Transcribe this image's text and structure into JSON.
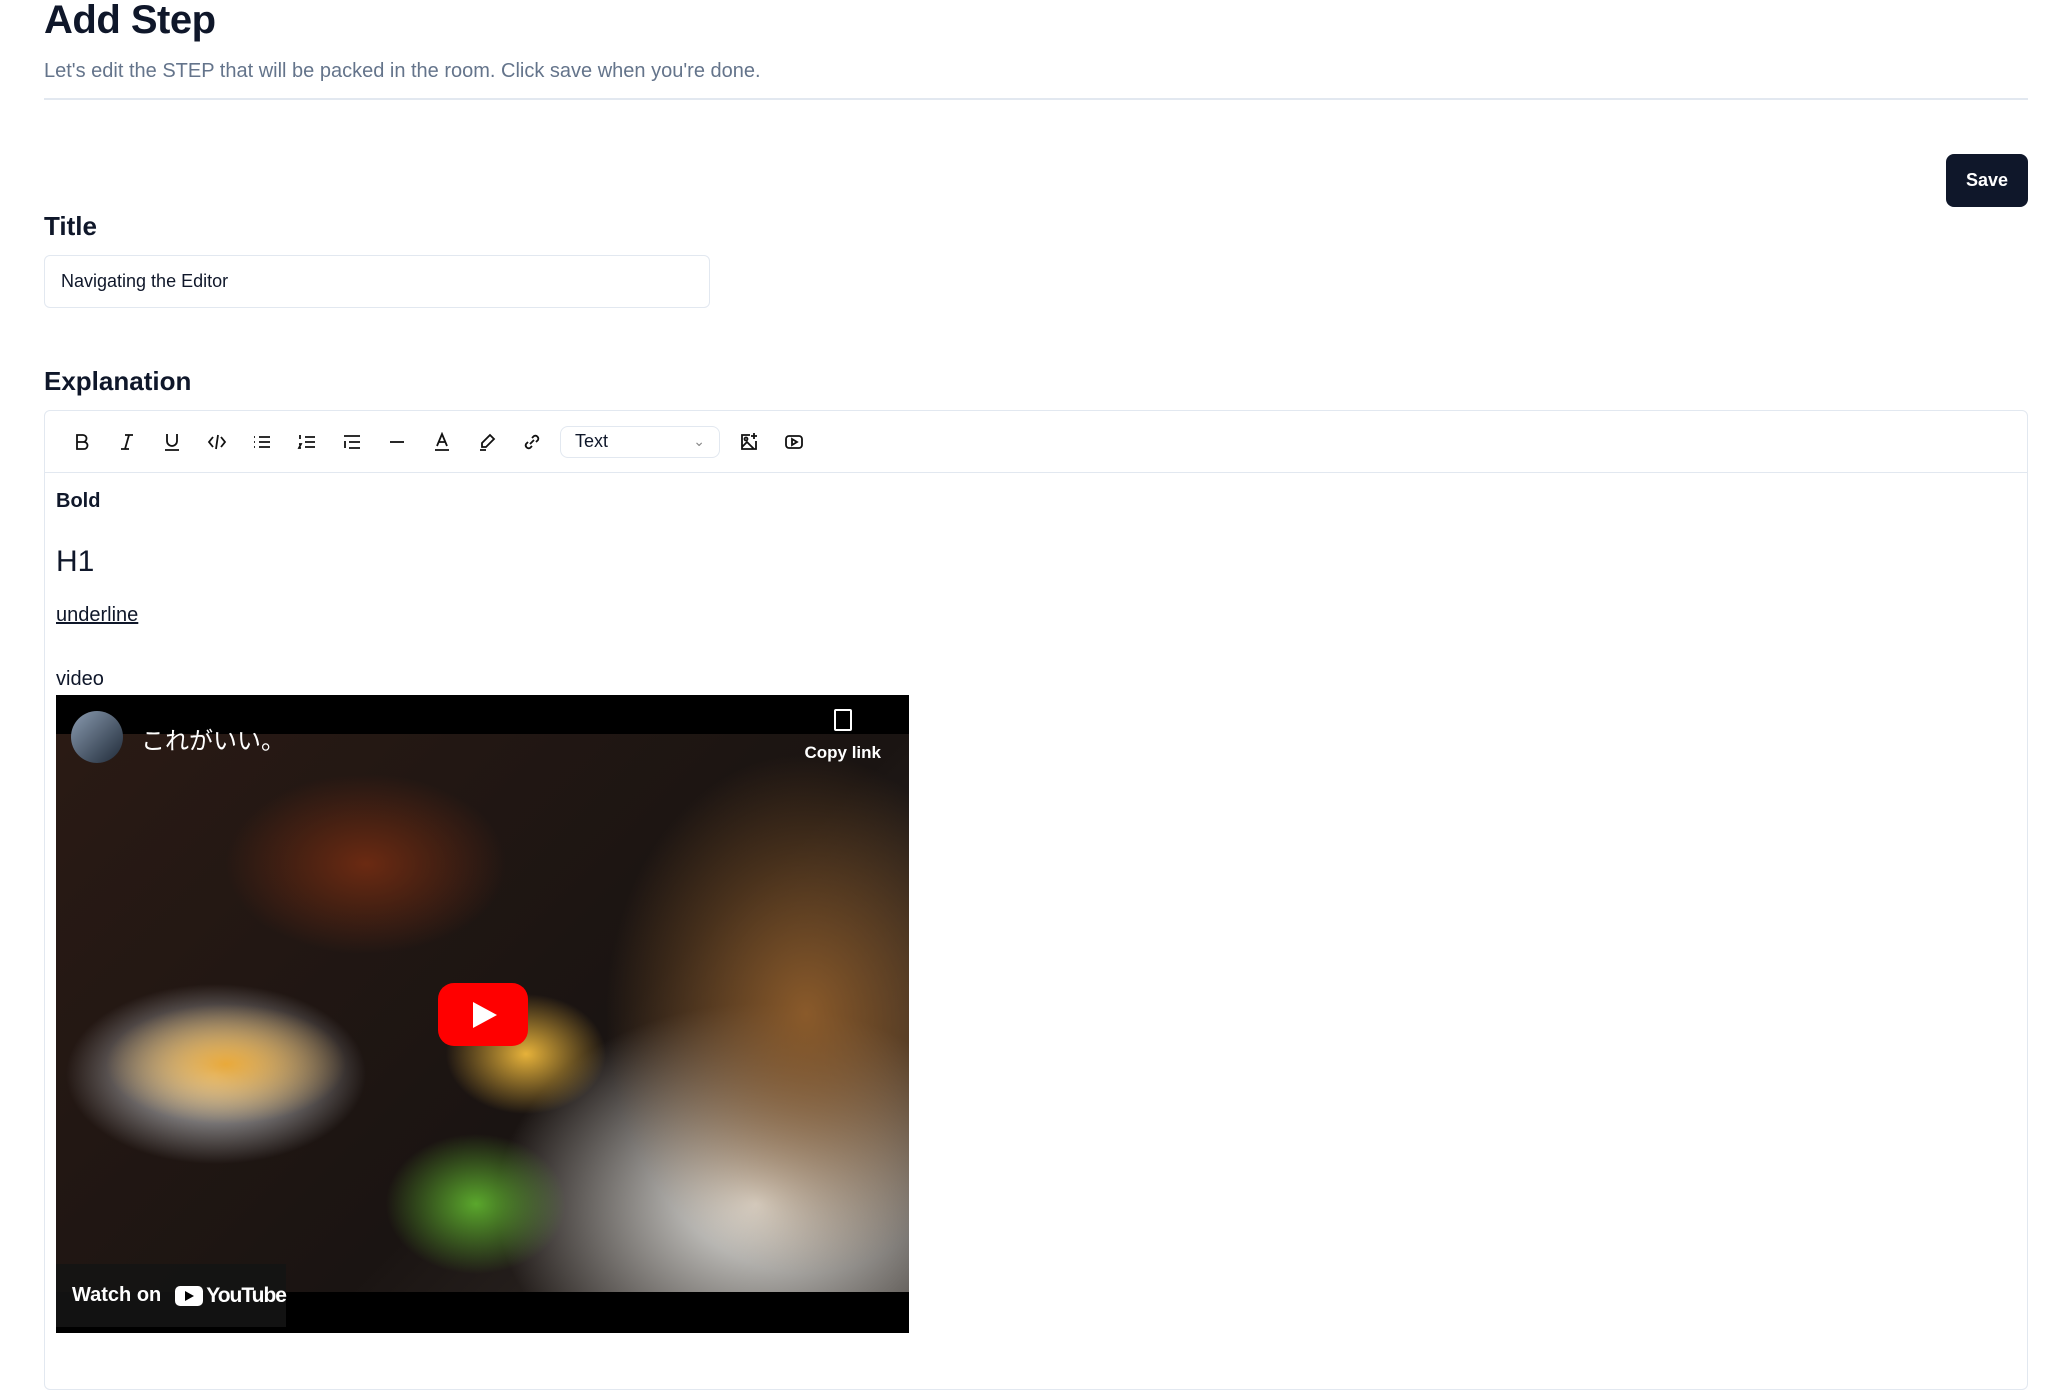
{
  "header": {
    "title": "Add Step",
    "subtitle": "Let's edit the STEP that will be packed in the room. Click save when you're done.",
    "save_label": "Save"
  },
  "title_field": {
    "label": "Title",
    "value": "Navigating the Editor"
  },
  "explanation": {
    "label": "Explanation",
    "toolbar": {
      "icons": [
        "bold-icon",
        "italic-icon",
        "underline-icon",
        "code-icon",
        "bullet-list-icon",
        "ordered-list-icon",
        "indent-icon",
        "horizontal-rule-icon",
        "text-color-icon",
        "highlight-icon",
        "link-icon",
        "image-add-icon",
        "video-icon"
      ],
      "block_type": "Text"
    },
    "content": {
      "bold": "Bold",
      "h1": "H1",
      "underline": "underline",
      "video_label": "video",
      "video": {
        "channel_title": "これがいい。",
        "copy_link": "Copy link",
        "watch_on": "Watch on",
        "youtube": "YouTube"
      }
    }
  }
}
